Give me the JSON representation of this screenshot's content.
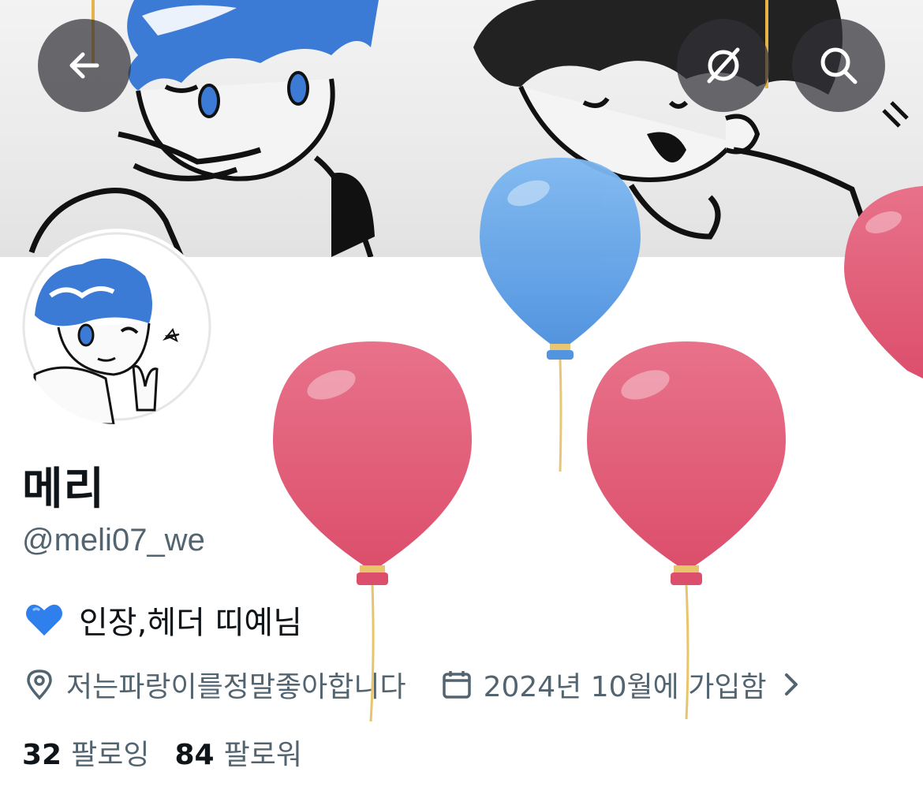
{
  "profile": {
    "display_name": "메리",
    "handle": "@meli07_we",
    "bio": "인장,헤더 띠예님",
    "bio_emoji": "blue-heart-icon",
    "location": "저는파랑이를정말좋아합니다",
    "joined": "2024년 10월에 가입함",
    "following_count": "32",
    "following_label": "팔로잉",
    "followers_count": "84",
    "followers_label": "팔로워"
  },
  "nav": {
    "back_icon": "arrow-left-icon",
    "grok_icon": "grok-icon",
    "search_icon": "search-icon"
  },
  "decorations": {
    "balloons": [
      "blue-balloon",
      "red-balloon",
      "red-balloon",
      "red-balloon"
    ]
  },
  "colors": {
    "secondary_text": "#536471",
    "primary_text": "#0f1419",
    "balloon_red": "#e05a74",
    "balloon_blue": "#5aa2e8",
    "hair_blue": "#3b7bd6"
  }
}
